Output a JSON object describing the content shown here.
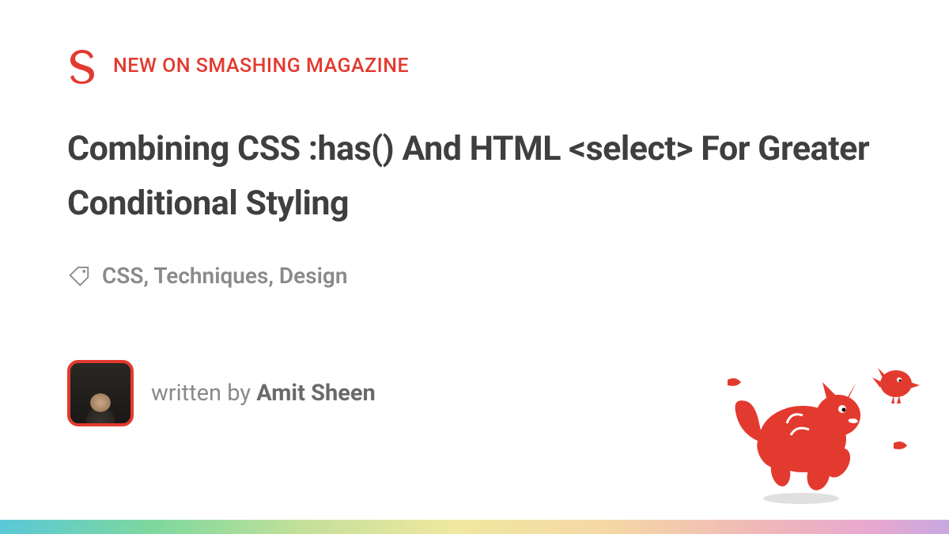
{
  "header": {
    "category_label": "NEW ON SMASHING MAGAZINE"
  },
  "article": {
    "title": "Combining CSS :has() And HTML <select> For Greater Conditional Styling",
    "tags": "CSS, Techniques, Design"
  },
  "author": {
    "written_by_prefix": "written by ",
    "name": "Amit Sheen"
  },
  "colors": {
    "brand": "#e33a2f",
    "title_text": "#3f3f3f",
    "meta_text": "#8a8a8a"
  }
}
